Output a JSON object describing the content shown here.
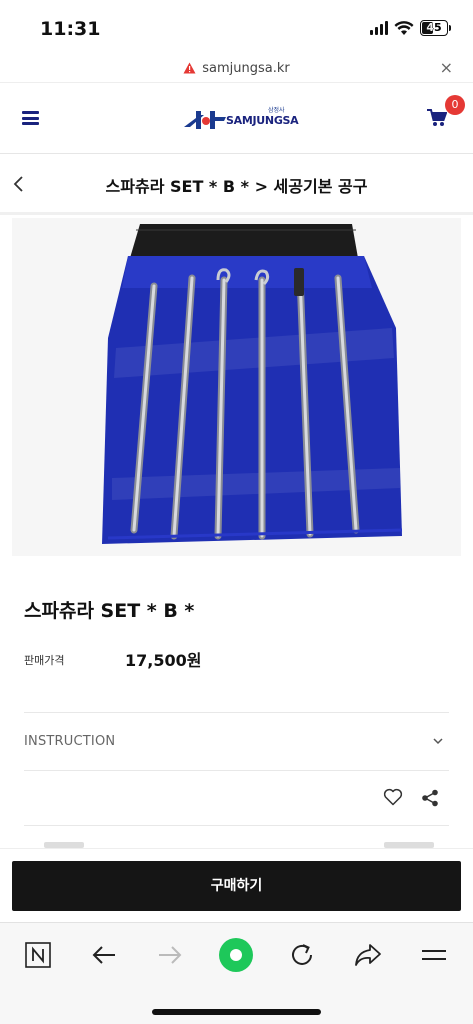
{
  "status_bar": {
    "time": "11:31",
    "battery": "45"
  },
  "url_bar": {
    "url": "samjungsa.kr",
    "close": "×"
  },
  "header": {
    "logo_small": "삼정사",
    "logo_text": "SAMJUNGSA",
    "cart_count": "0"
  },
  "breadcrumb": {
    "title": "스파츄라 SET * B * > 세공기본 공구"
  },
  "product": {
    "name": "스파츄라 SET * B *",
    "price_label": "판매가격",
    "price": "17,500원"
  },
  "instruction": {
    "label": "INSTRUCTION"
  },
  "buy": {
    "label": "구매하기"
  },
  "colors": {
    "brand": "#1a237e",
    "badge": "#e53935",
    "buy_button": "#151515",
    "toolbar_green": "#1ec85a"
  },
  "toolbar": {
    "icons": [
      "naver-n-icon",
      "back-arrow-icon",
      "forward-arrow-icon",
      "green-dot-icon",
      "reload-icon",
      "share-arrow-icon",
      "menu-icon"
    ]
  }
}
